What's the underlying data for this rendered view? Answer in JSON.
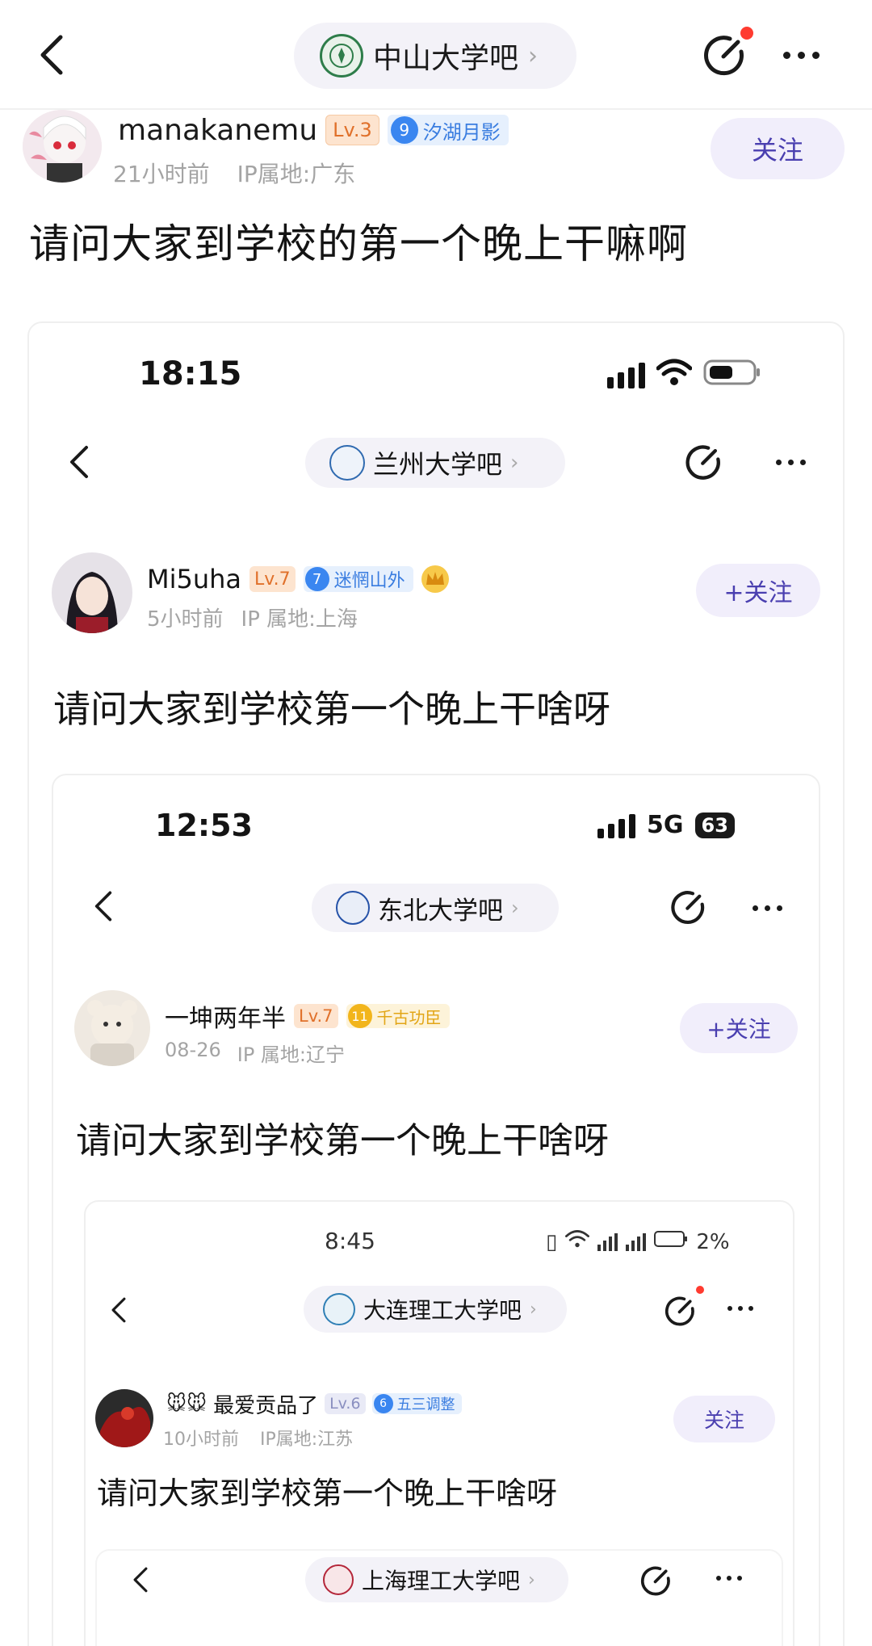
{
  "header": {
    "forum_name": "中山大学吧",
    "back_icon": "back-arrow-icon",
    "compose_icon": "compose-icon",
    "more_icon": "more-icon",
    "notification_color": "#ff3b30"
  },
  "post": {
    "author": "manakanemu",
    "level": "Lv.3",
    "badge_level": "9",
    "badge_text": "汐湖月影",
    "time": "21小时前",
    "ip": "IP属地:广东",
    "follow_label": "关注",
    "title": "请问大家到学校的第一个晚上干嘛啊"
  },
  "nested": [
    {
      "status_time": "18:15",
      "forum_name": "兰州大学吧",
      "author": "Mi5uha",
      "level": "Lv.7",
      "badge_level": "7",
      "badge_text": "迷惘山外",
      "time": "5小时前",
      "ip": "IP 属地:上海",
      "follow_label": "+关注",
      "title": "请问大家到学校第一个晚上干啥呀"
    },
    {
      "status_time": "12:53",
      "network": "5G",
      "battery": "63",
      "forum_name": "东北大学吧",
      "author": "一坤两年半",
      "level": "Lv.7",
      "badge_level": "11",
      "badge_text": "千古功臣",
      "time": "08-26",
      "ip": "IP 属地:辽宁",
      "follow_label": "+关注",
      "title": "请问大家到学校第一个晚上干啥呀"
    },
    {
      "status_time": "8:45",
      "battery": "2%",
      "forum_name": "大连理工大学吧",
      "author_emoji": "🐭🐭",
      "author": "最爱贡品了",
      "level": "Lv.6",
      "badge_level": "6",
      "badge_text": "五三调整",
      "time": "10小时前",
      "ip": "IP属地:江苏",
      "follow_label": "关注",
      "title": "请问大家到学校第一个晚上干啥呀"
    },
    {
      "forum_name": "上海理工大学吧"
    }
  ],
  "colors": {
    "accent": "#4a3fb0",
    "follow_bg": "#f1eefb",
    "pill_bg": "#f3f2f8",
    "level_bg": "#fde4cf",
    "level_text": "#e0702a",
    "badge_blue": "#3a86f0",
    "badge_gold": "#f2b51c"
  }
}
